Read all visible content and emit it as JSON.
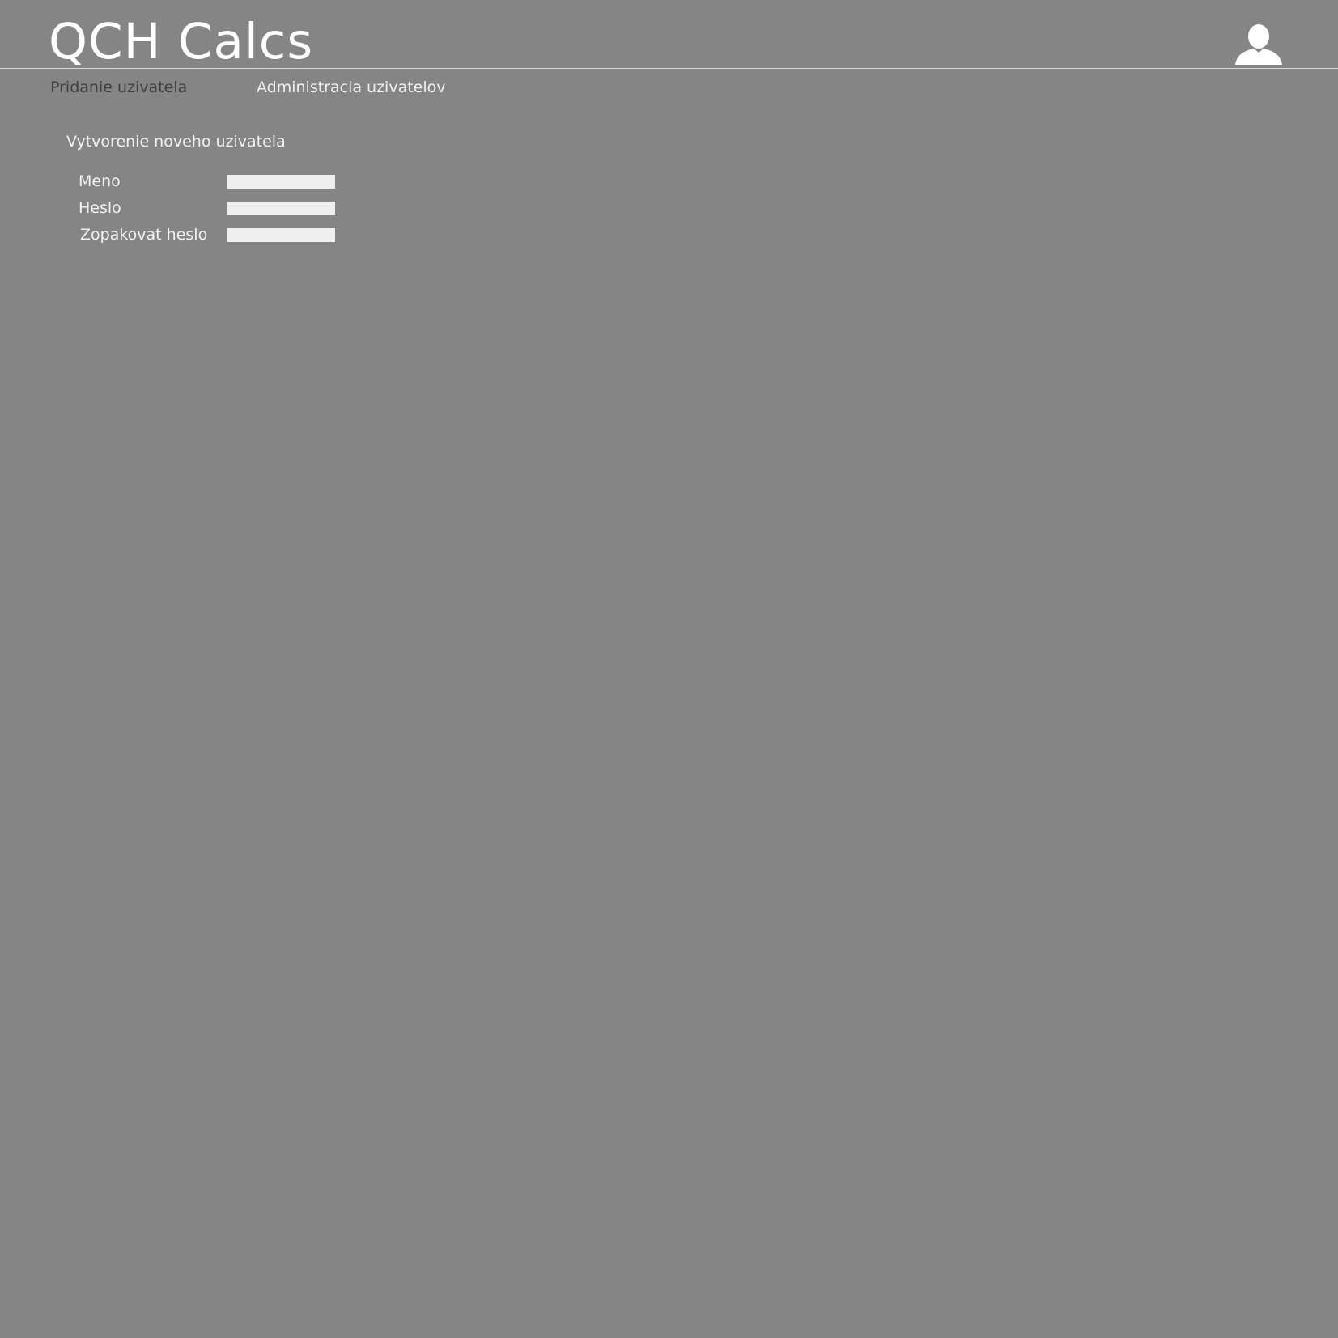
{
  "header": {
    "app_title": "QCH Calcs",
    "user_icon": "user-icon"
  },
  "nav": {
    "items": [
      {
        "label": "Pridanie uzivatela",
        "active": true
      },
      {
        "label": "Administracia uzivatelov",
        "active": false
      }
    ]
  },
  "form": {
    "title": "Vytvorenie noveho uzivatela",
    "fields": [
      {
        "label": "Meno",
        "value": ""
      },
      {
        "label": "Heslo",
        "value": ""
      },
      {
        "label": "Zopakovat heslo",
        "value": ""
      }
    ]
  },
  "colors": {
    "background": "#858585",
    "text": "#f2f2f2",
    "active_nav": "#3f3f3f",
    "input_bg": "#efefef",
    "header_rule": "#d7d7d7"
  }
}
